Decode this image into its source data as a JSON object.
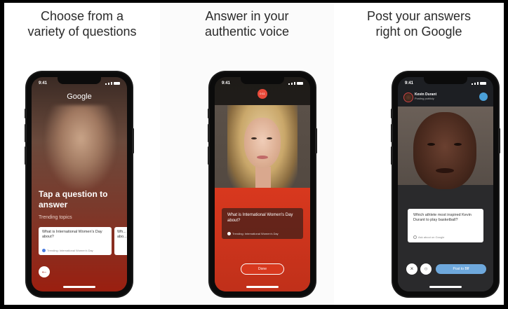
{
  "panels": [
    {
      "caption_line1": "Choose from a",
      "caption_line2": "variety of questions",
      "status_time": "9:41",
      "app_logo": "Google",
      "prompt_title": "Tap a question to answer",
      "section_label": "Trending topics",
      "card_question": "What is International Women's Day about?",
      "card_meta": "Trending: International Women's Day",
      "card2_question": "Wh... abo...",
      "back_icon": "back-arrow-icon"
    },
    {
      "caption_line1": "Answer in your",
      "caption_line2": "authentic voice",
      "status_time": "9:41",
      "rec_label": "0:11",
      "card_question": "What is International Women's Day about?",
      "card_meta": "Trending: International Women's Day",
      "record_label": "Done"
    },
    {
      "caption_line1": "Post your answers",
      "caption_line2": "right on Google",
      "status_time": "9:41",
      "user_name": "Kevin Durant",
      "user_status": "Posting publicly",
      "card_question": "Which athlete most inspired Kevin Durant to play basketball?",
      "card_meta": "Ask about on Google",
      "post_label": "Post to Bff"
    }
  ],
  "colors": {
    "accent_red": "#d8381e",
    "accent_blue": "#6ea8dc"
  }
}
